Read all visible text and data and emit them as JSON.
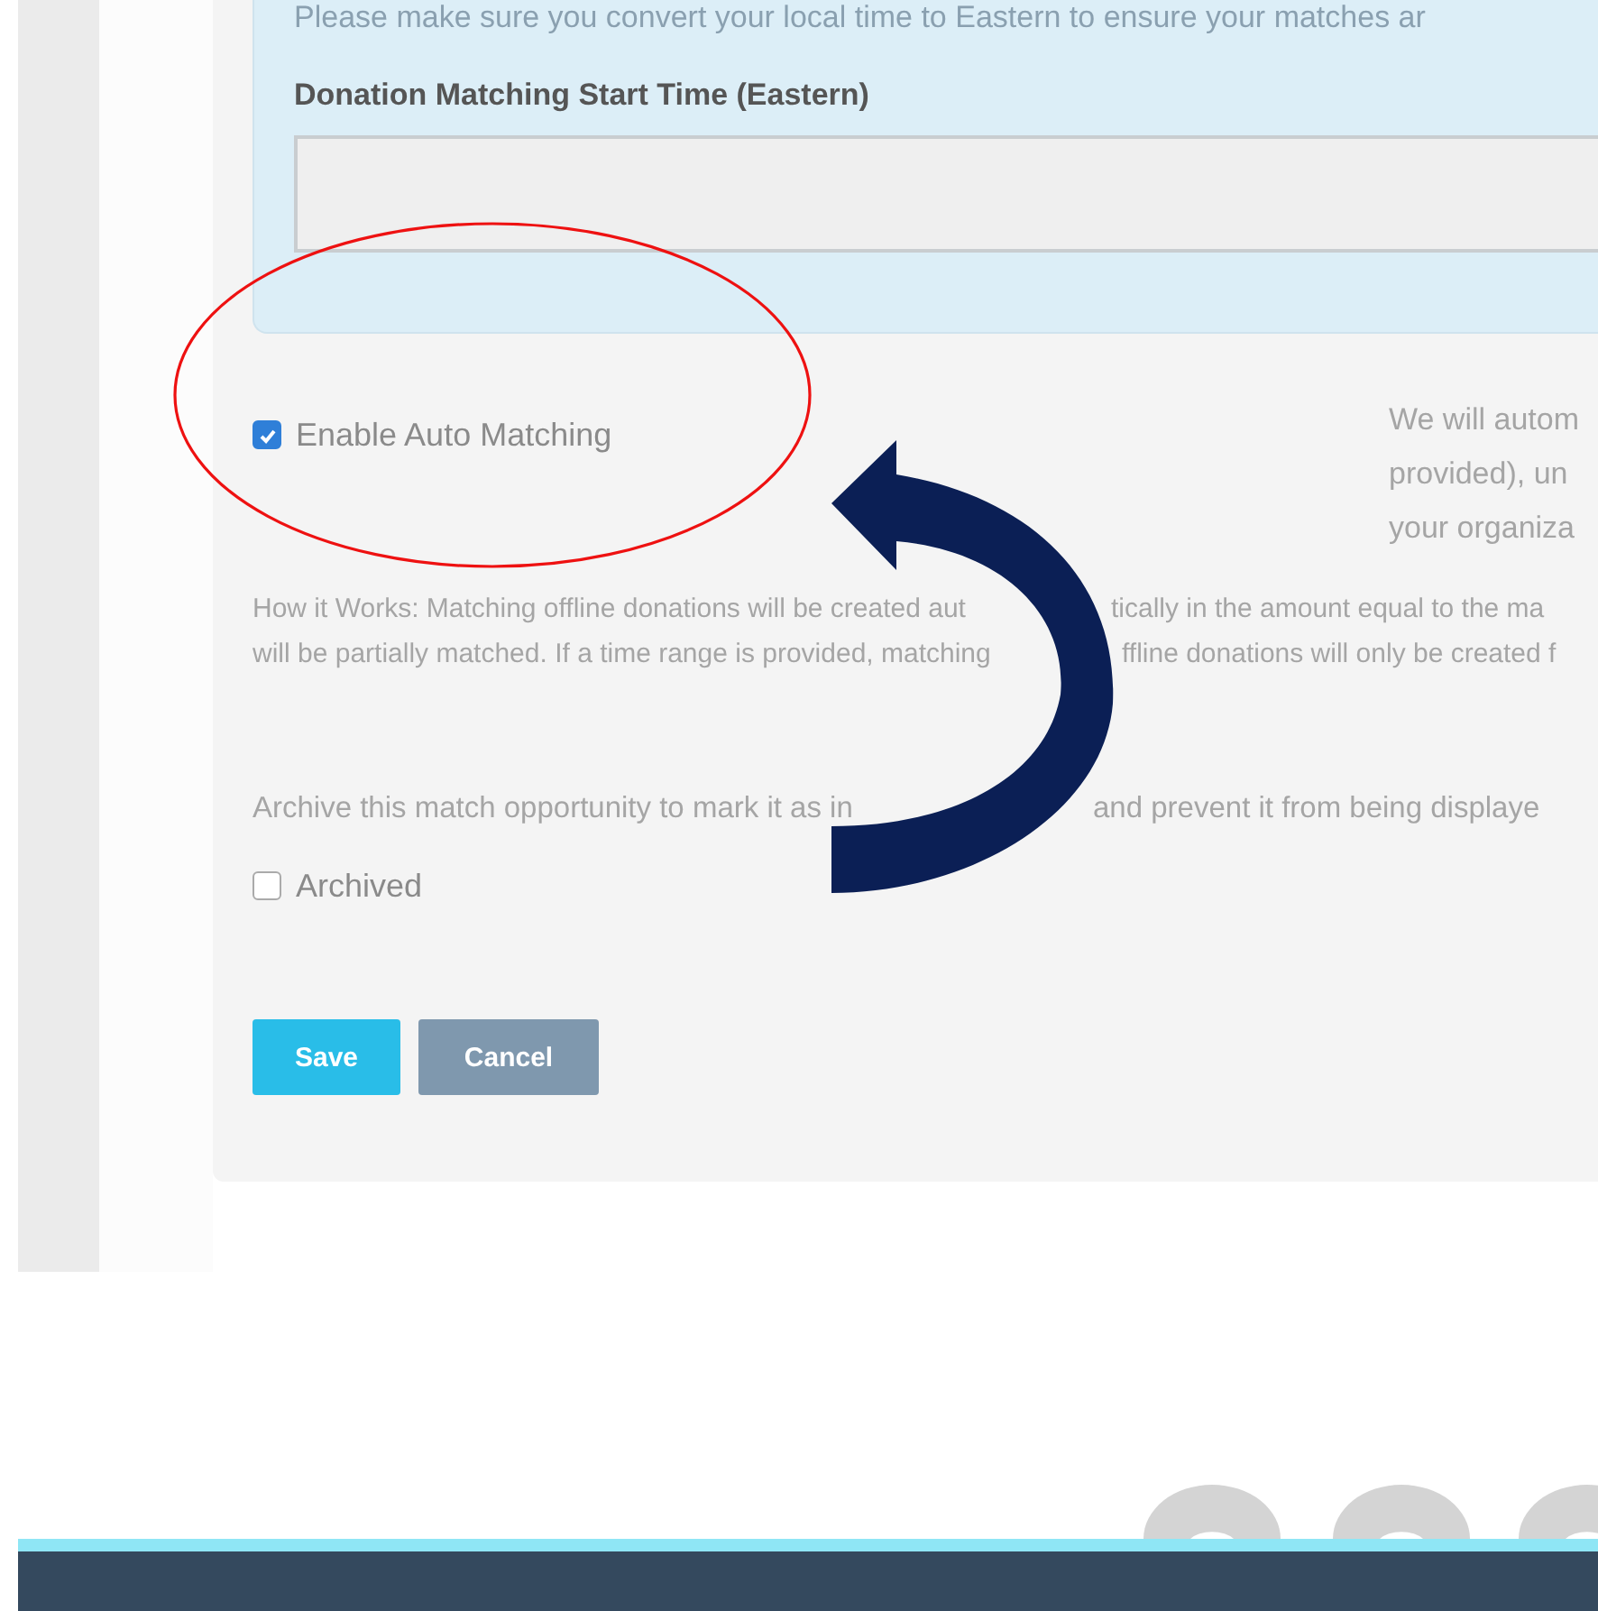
{
  "time_panel": {
    "notice": "Please make sure you convert your local time to Eastern to ensure your matches ar",
    "start_time": {
      "label": "Donation Matching Start Time (Eastern)"
    }
  },
  "auto_matching": {
    "label": "Enable Auto Matching",
    "checked": true,
    "description_lines": [
      "We will autom",
      "provided), un",
      "your organiza"
    ]
  },
  "how_it_works_lines": [
    {
      "segments": [
        "How it Works: Matching offline donations will be created aut",
        "tically in the amount equal to the ma"
      ]
    },
    {
      "segments": [
        "will be partially matched. If a time range is provided, matching",
        "ffline donations will only be created f"
      ]
    }
  ],
  "archive": {
    "description_segments": [
      "Archive this match opportunity to mark it as in",
      "and prevent it from being displaye"
    ],
    "label": "Archived",
    "checked": false
  },
  "buttons": [
    {
      "label": "Save",
      "kind": "primary"
    },
    {
      "label": "Cancel",
      "kind": "secondary"
    }
  ]
}
